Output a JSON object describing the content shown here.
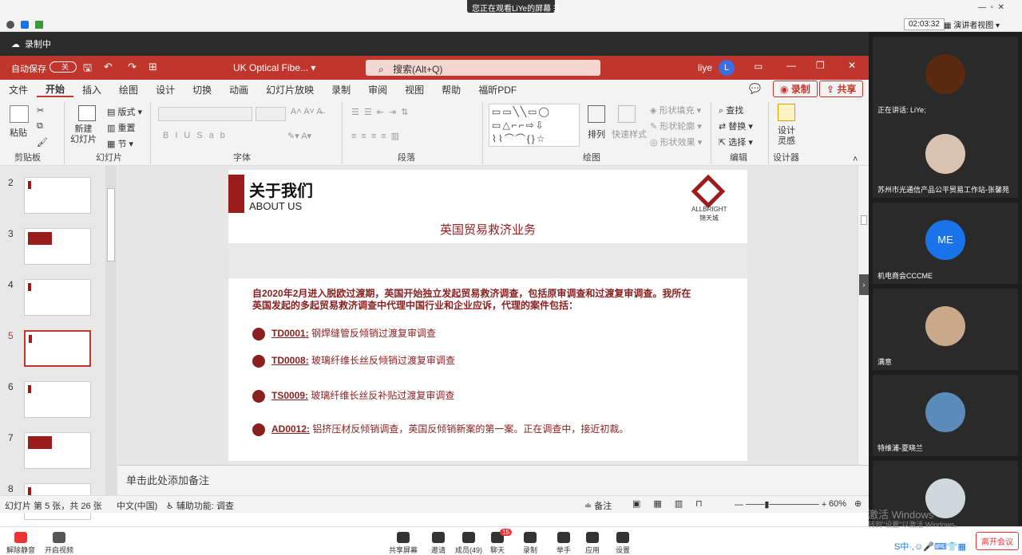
{
  "meeting": {
    "banner": "您正在观看LiYe的屏幕",
    "timer": "02:03:32",
    "view_mode": "演讲者视图",
    "recording": "录制中"
  },
  "ppt": {
    "autosave": "自动保存",
    "autosave_state": "关",
    "filename": "UK Optical Fibe...",
    "search_placeholder": "搜索(Alt+Q)",
    "user": "liye",
    "user_initial": "L",
    "tabs": [
      "文件",
      "开始",
      "插入",
      "绘图",
      "设计",
      "切换",
      "动画",
      "幻灯片放映",
      "录制",
      "审阅",
      "视图",
      "帮助",
      "福昕PDF"
    ],
    "record_button": "录制",
    "share_button": "共享",
    "groups": {
      "clipboard": "剪贴板",
      "slides": "幻灯片",
      "font": "字体",
      "paragraph": "段落",
      "drawing": "绘图",
      "editing": "编辑",
      "designer": "设计器"
    },
    "ribbon": {
      "paste": "粘贴",
      "new_slide": "新建\n幻灯片",
      "layout": "版式",
      "reset": "重置",
      "section": "节",
      "arrange": "排列",
      "quick_styles": "快速样式",
      "shape_fill": "形状填充",
      "shape_outline": "形状轮廓",
      "shape_effects": "形状效果",
      "find": "查找",
      "replace": "替换",
      "select": "选择",
      "design_ideas": "设计\n灵感"
    },
    "thumbnail_numbers": [
      "2",
      "3",
      "4",
      "5",
      "6",
      "7",
      "8"
    ],
    "notes_placeholder": "单击此处添加备注",
    "status": {
      "slide_info": "幻灯片 第 5 张，共 26 张",
      "language": "中文(中国)",
      "accessibility": "辅助功能: 调查",
      "notes": "备注",
      "zoom": "60%"
    }
  },
  "slide": {
    "title_cn": "关于我们",
    "title_en": "ABOUT US",
    "logo_en": "ALLBRIGHT",
    "logo_cn": "锦天城",
    "subtitle": "英国贸易救济业务",
    "intro": "自2020年2月进入脱欧过渡期，英国开始独立发起贸易救济调查，包括原审调查和过渡复审调查。我所在英国发起的多起贸易救济调查中代理中国行业和企业应诉，代理的案件包括：",
    "cases": [
      {
        "code": "TD0001:",
        "desc": "钢焊缝管反倾销过渡复审调查"
      },
      {
        "code": "TD0008:",
        "desc": "玻璃纤维长丝反倾销过渡复审调查"
      },
      {
        "code": "TS0009:",
        "desc": "玻璃纤维长丝反补贴过渡复审调查"
      },
      {
        "code": "AD0012:",
        "desc": "铝挤压材反倾销调查，英国反倾销新案的第一案。正在调查中，接近初裁。"
      }
    ]
  },
  "participants": [
    {
      "name": "正在讲话: LiYe;",
      "color": "#5a2a10"
    },
    {
      "name": "苏州市光通信产品公平贸易工作站-张馨苑",
      "color": "#d9c3b0"
    },
    {
      "name": "机电商会CCCME",
      "initials": "ME",
      "color": "#1a73e8"
    },
    {
      "name": "满意",
      "color": "#c9a98a"
    },
    {
      "name": "特维浦-夏晓兰",
      "color": "#5b8bb8"
    },
    {
      "name": "",
      "color": "#cfd8dc"
    }
  ],
  "bottom_bar": {
    "left": [
      "解除静音",
      "开启视频"
    ],
    "center": [
      "共享屏幕",
      "邀请",
      "成员(49)",
      "聊天",
      "录制",
      "举手",
      "应用",
      "设置"
    ],
    "chat_badge": "15",
    "leave": "离开会议"
  },
  "watermark": {
    "line1": "激活 Windows",
    "line2": "转到\"设置\"以激活 Windows。"
  },
  "colors": {
    "accent": "#c0362c",
    "slide_red": "#8a1f1f"
  }
}
